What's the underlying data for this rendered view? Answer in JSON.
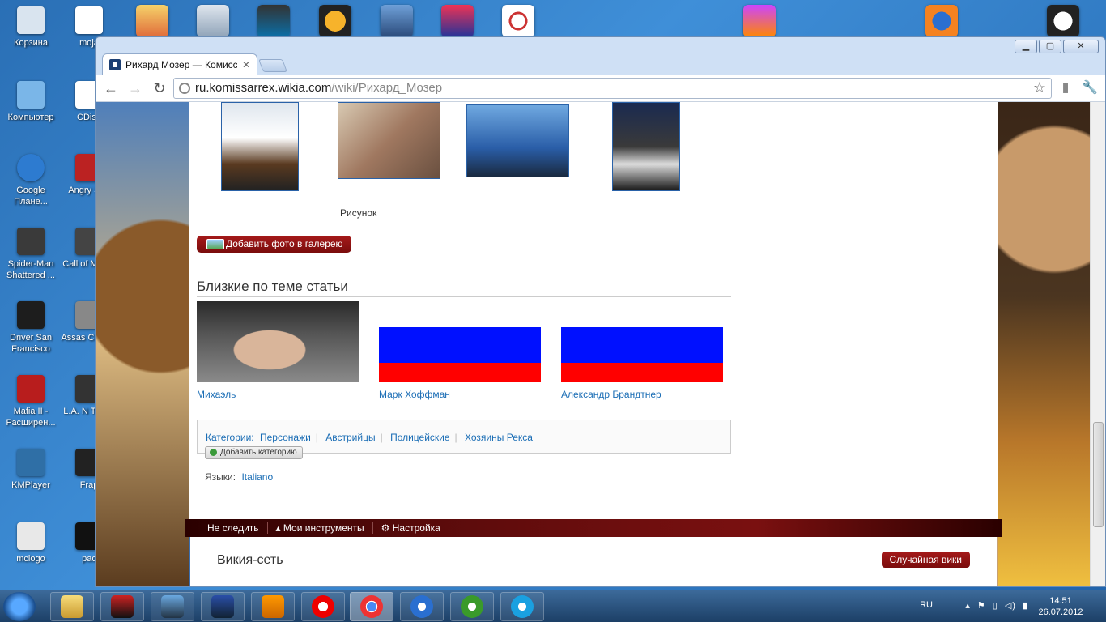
{
  "desktop": {
    "icons": [
      {
        "label": "Корзина",
        "color": "#d9e4ef"
      },
      {
        "label": "Компьютер",
        "color": "#7ab6e8"
      },
      {
        "label": "Google Плане...",
        "color": "#2d7bd0"
      },
      {
        "label": "Spider-Man Shattered ...",
        "color": "#3a3a3a"
      },
      {
        "label": "Driver San Francisco",
        "color": "#1d1d1d"
      },
      {
        "label": "Mafia II - Расширен...",
        "color": "#b81d1d"
      },
      {
        "label": "KMPlayer",
        "color": "#2f6fa6"
      },
      {
        "label": "mclogo",
        "color": "#e8e8e8"
      }
    ],
    "icons_col2": [
      {
        "label": "moja",
        "color": "#ffffff"
      },
      {
        "label": "CDisp",
        "color": "#ffffff"
      },
      {
        "label": "Angry Spa",
        "color": "#b22"
      },
      {
        "label": "Call of Moder",
        "color": "#444"
      },
      {
        "label": "Assas Creed I",
        "color": "#888"
      },
      {
        "label": "L.A. N The C",
        "color": "#333"
      },
      {
        "label": "Frap",
        "color": "#222"
      },
      {
        "label": "pac",
        "color": "#111"
      }
    ]
  },
  "browser": {
    "tab_title": "Рихард Мозер — Комиссар",
    "url_host": "ru.komissarrex.wikia.com",
    "url_path": "/wiki/Рихард_Мозер",
    "window_controls": {
      "minimize": "▁",
      "maximize": "▢",
      "close": "✕"
    }
  },
  "page": {
    "gallery_caption": "Рисунок",
    "add_photo_label": "Добавить фото в галерею",
    "related_title": "Близкие по теме статьи",
    "related": [
      {
        "name": "Михаэль"
      },
      {
        "name": "Марк Хоффман"
      },
      {
        "name": "Александр Брандтнер"
      }
    ],
    "categories_label": "Категории:",
    "categories": [
      "Персонажи",
      "Австрийцы",
      "Полицейские",
      "Хозяины Рекса"
    ],
    "add_category_label": "Добавить категорию",
    "languages_label": "Языки:",
    "language_link": "Italiano",
    "wikibar": {
      "unfollow": "Не следить",
      "my_tools": "Мои инструменты",
      "settings": "Настройка"
    },
    "wikinet_title": "Викия-сеть",
    "random_wiki": "Случайная вики"
  },
  "taskbar": {
    "lang": "RU",
    "time": "14:51",
    "date": "26.07.2012"
  }
}
